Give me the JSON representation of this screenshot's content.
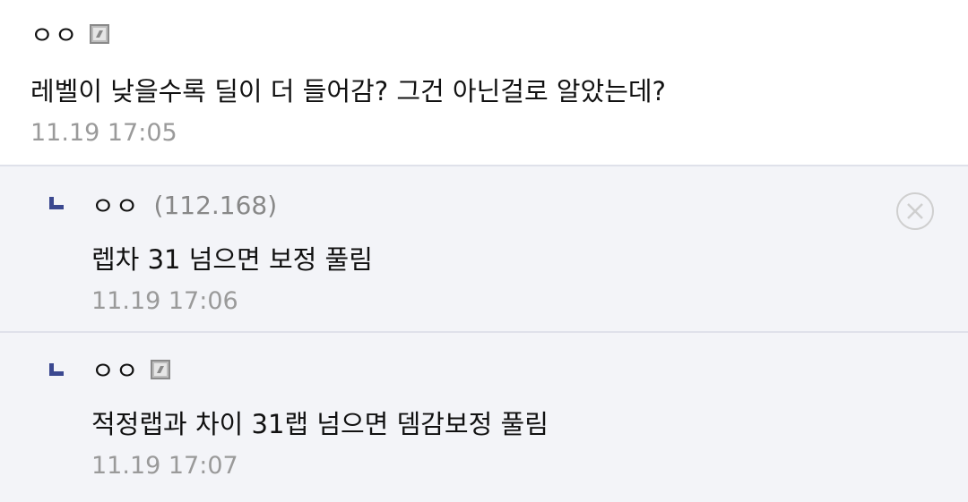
{
  "comments": [
    {
      "nickname": "ㅇㅇ",
      "badge_icon": "fixed-nick-badge-icon",
      "text": "레벨이 낮을수록 딜이 더 들어감? 그건 아닌걸로 알았는데?",
      "time": "11.19 17:05"
    }
  ],
  "replies": [
    {
      "nickname": "ㅇㅇ",
      "ip": "(112.168)",
      "text": "렙차 31 넘으면 보정 풀림",
      "time": "11.19 17:06",
      "delete_icon": "close-circle-icon"
    },
    {
      "nickname": "ㅇㅇ",
      "badge_icon": "fixed-nick-badge-icon",
      "text": "적정랩과 차이 31랩 넘으면 뎀감보정 풀림",
      "time": "11.19 17:07"
    }
  ],
  "colors": {
    "reply_bg": "#f3f4f8",
    "reply_arrow": "#3b4890",
    "time": "#9a9a9a"
  }
}
